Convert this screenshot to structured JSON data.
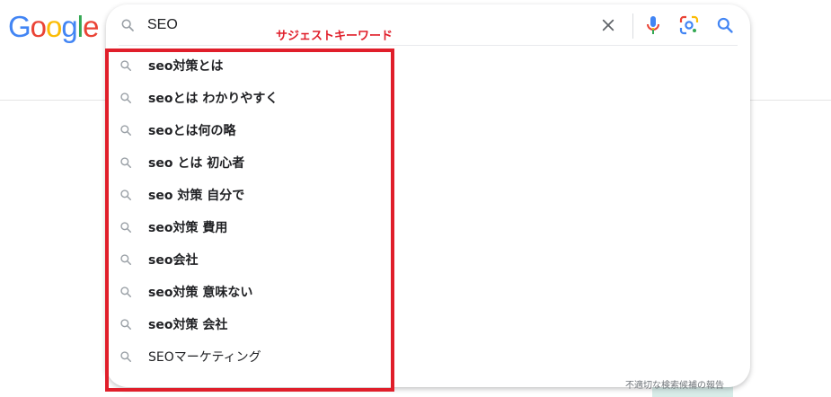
{
  "logo": {
    "letters": [
      "G",
      "o",
      "o",
      "g",
      "l",
      "e"
    ]
  },
  "colors": {
    "blue": "#4285F4",
    "red": "#EA4335",
    "yellow": "#FBBC05",
    "green": "#34A853",
    "annotation": "#e01e2a",
    "text": "#202124",
    "muted": "#70757a"
  },
  "search": {
    "value": "SEO"
  },
  "annotation_label": "サジェストキーワード",
  "suggestions": [
    {
      "label": "seo対策とは"
    },
    {
      "label": "seoとは わかりやすく"
    },
    {
      "label": "seoとは何の略"
    },
    {
      "label": "seo とは 初心者"
    },
    {
      "label": "seo 対策 自分で"
    },
    {
      "label": "seo対策 費用"
    },
    {
      "label": "seo会社"
    },
    {
      "label": "seo対策 意味ない"
    },
    {
      "label": "seo対策 会社"
    },
    {
      "label": "SEOマーケティング"
    }
  ],
  "report_link": "不適切な検索候補の報告",
  "icons": [
    "search-icon",
    "clear-icon",
    "microphone-icon",
    "lens-icon"
  ]
}
